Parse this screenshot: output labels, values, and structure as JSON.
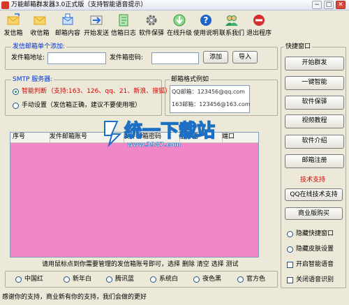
{
  "window": {
    "title": "万能邮箱群发器3.0正式版（支持智能语音提示）",
    "min_label": "−",
    "max_label": "□",
    "close_label": "✕"
  },
  "toolbar": {
    "items": [
      {
        "label": "发信箱",
        "icon": "outbox-envelope-icon",
        "color": "#e8a317"
      },
      {
        "label": "收信箱",
        "icon": "inbox-envelope-icon",
        "color": "#e8a317"
      },
      {
        "label": "邮箱内容",
        "icon": "mail-content-icon",
        "color": "#2a6fd6"
      },
      {
        "label": "开始发送",
        "icon": "send-icon",
        "color": "#7a7a7a"
      },
      {
        "label": "信箱日志",
        "icon": "log-book-icon",
        "color": "#2f9a3a"
      },
      {
        "label": "软件保驿",
        "icon": "gear-icon",
        "color": "#6b6b6b"
      },
      {
        "label": "在线升级",
        "icon": "download-arrow-icon",
        "color": "#2e9c3d"
      },
      {
        "label": "使用说明",
        "icon": "help-icon",
        "color": "#1f63c9"
      },
      {
        "label": "联系我们",
        "icon": "contact-icon",
        "color": "#2c9a5c"
      },
      {
        "label": "退出程序",
        "icon": "exit-stop-icon",
        "color": "#d32f2f"
      }
    ]
  },
  "add_group": {
    "legend": "发信邮箱单个添加:",
    "address_label": "发件箱地址:",
    "address_value": "",
    "password_label": "发件箱密码:",
    "password_value": "",
    "add_button": "添加",
    "import_button": "导入"
  },
  "smtp_group": {
    "legend": "SMTP 服务器:",
    "smart_label": "智能判断",
    "smart_note": "（支持:163、126、qq、21、新浪、搜狐）",
    "manual_label": "手动设置（发信箱正确，建议不要使用哦）"
  },
  "format_group": {
    "legend": "邮箱格式例如",
    "lines": [
      "QQ邮箱：123456@qq.com",
      "163邮箱：123456@163.com"
    ]
  },
  "table": {
    "columns": [
      "序号",
      "发件邮箱账号",
      "发件邮箱密码",
      "服务器",
      "端口"
    ],
    "rows": []
  },
  "hint": "请用鼠标点到你需要管理的发信箱账号即可，选择 删除 清空 选择 测试",
  "skins": [
    {
      "label": "中国红",
      "selected": false
    },
    {
      "label": "新年白",
      "selected": false
    },
    {
      "label": "腾讯蓝",
      "selected": false
    },
    {
      "label": "系统白",
      "selected": false
    },
    {
      "label": "夜色黑",
      "selected": false
    },
    {
      "label": "官方色",
      "selected": false
    }
  ],
  "status": "感谢你的支持，商业新有你的支持，我们会做的更好",
  "sidebar": {
    "legend": "快捷窗口",
    "buttons": [
      "开始群发",
      "一键智能",
      "软件保驿",
      "视频教程",
      "软件介绍",
      "邮箱注册"
    ],
    "support_label": "技术支持",
    "qq_button": "QQ在线技术支持",
    "buy_button": "商业版购买",
    "radios": [
      "隐藏快捷窗口",
      "隐藏皮肤设置"
    ],
    "checks": [
      "开启智能语音",
      "关闭语音识别"
    ]
  },
  "watermark": {
    "main": "统一下载站",
    "sub": "www.3987.com"
  },
  "colors": {
    "background": "#ECE9D8",
    "table_fill": "#F287C8",
    "accent_red": "#D80000",
    "legend_blue": "#0033CC"
  }
}
